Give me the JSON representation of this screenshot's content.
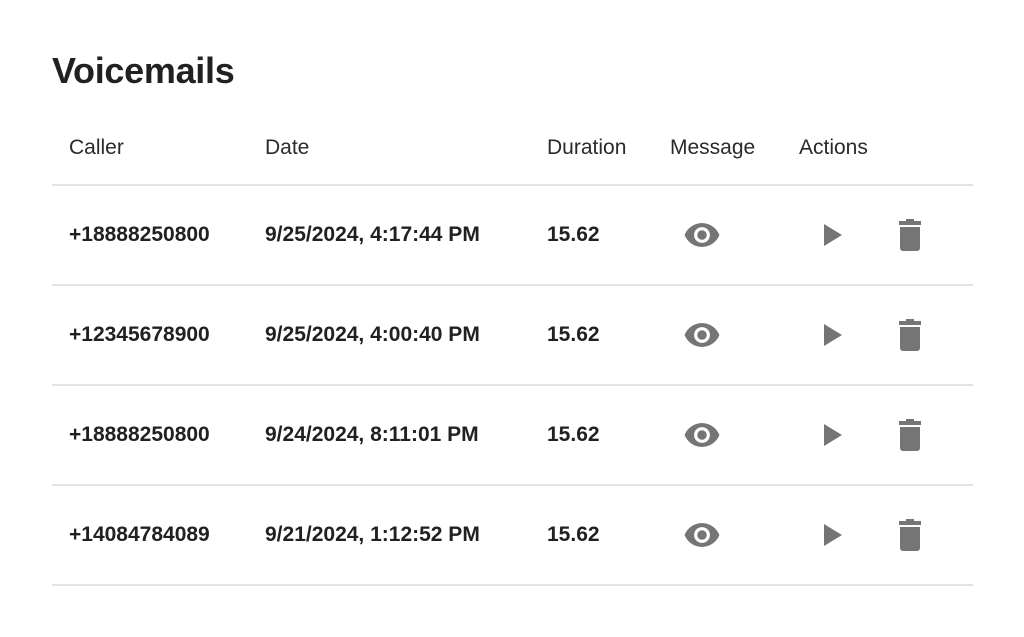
{
  "page": {
    "title": "Voicemails"
  },
  "colors": {
    "text": "#212121",
    "icon": "#757575",
    "divider": "#e2e2e2"
  },
  "table": {
    "columns": [
      "Caller",
      "Date",
      "Duration",
      "Message",
      "Actions"
    ],
    "rows": [
      {
        "caller": "+18888250800",
        "date": "9/25/2024, 4:17:44 PM",
        "duration": "15.62",
        "message_icon": "eye-icon",
        "actions": [
          "play-icon",
          "trash-icon"
        ]
      },
      {
        "caller": "+12345678900",
        "date": "9/25/2024, 4:00:40 PM",
        "duration": "15.62",
        "message_icon": "eye-icon",
        "actions": [
          "play-icon",
          "trash-icon"
        ]
      },
      {
        "caller": "+18888250800",
        "date": "9/24/2024, 8:11:01 PM",
        "duration": "15.62",
        "message_icon": "eye-icon",
        "actions": [
          "play-icon",
          "trash-icon"
        ]
      },
      {
        "caller": "+14084784089",
        "date": "9/21/2024, 1:12:52 PM",
        "duration": "15.62",
        "message_icon": "eye-icon",
        "actions": [
          "play-icon",
          "trash-icon"
        ]
      }
    ]
  }
}
